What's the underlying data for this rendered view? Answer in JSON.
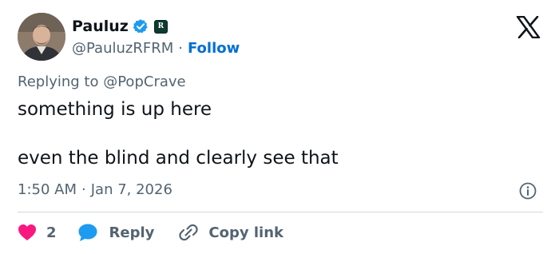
{
  "author": {
    "display_name": "Pauluz",
    "handle": "@PauluzRFRM",
    "separator": "·",
    "follow_label": "Follow",
    "affiliate_letter": "R"
  },
  "icons": {
    "verified": "verified-badge-icon",
    "affiliate": "affiliate-badge-icon",
    "platform": "x-logo-icon",
    "info": "info-icon",
    "like": "heart-icon",
    "reply": "reply-bubble-icon",
    "copy": "link-icon"
  },
  "reply_context": {
    "prefix": "Replying to",
    "mention": "@PopCrave"
  },
  "tweet": {
    "line1": "something is up here",
    "line2": "even the blind and clearly see that"
  },
  "meta": {
    "time": "1:50 AM",
    "separator": "·",
    "date": "Jan 7, 2026"
  },
  "actions": {
    "like_count": "2",
    "reply_label": "Reply",
    "copy_label": "Copy link"
  },
  "colors": {
    "like": "#f91880",
    "reply": "#1d9bf0",
    "link": "#006fd6",
    "verified": "#1d9bf0",
    "muted": "#536471",
    "text": "#0f1419",
    "affiliate_bg": "#0d3b2e"
  }
}
